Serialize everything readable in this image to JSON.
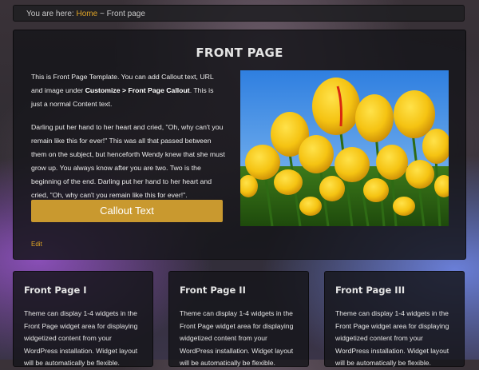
{
  "breadcrumb": {
    "prefix": "You are here:",
    "home_label": "Home",
    "separator": "~",
    "current": "Front page"
  },
  "main": {
    "title": "FRONT PAGE",
    "intro_text_1": "This is Front Page Template. You can add Callout text, URL and image under ",
    "intro_bold": "Customize > Front Page Callout",
    "intro_text_2": ". This is just a normal Content text.",
    "paragraph": "Darling put her hand to her heart and cried, \"Oh, why can't you remain like this for ever!\" This was all that passed between them on the subject, but henceforth Wendy knew that she must grow up. You always know after you are two. Two is the beginning of the end. Darling put her hand to her heart and cried, \"Oh, why can't you remain like this for ever!\".",
    "callout_label": "Callout Text",
    "edit_label": "Edit",
    "image_icon": "tulips-photo"
  },
  "widgets": [
    {
      "title": "Front Page I",
      "text": "Theme can display 1-4 widgets in the Front Page widget area for displaying widgetized content from your WordPress installation. Widget layout will be automatically be flexible."
    },
    {
      "title": "Front Page II",
      "text": "Theme can display 1-4 widgets in the Front Page widget area for displaying widgetized content from your WordPress installation. Widget layout will be automatically be flexible."
    },
    {
      "title": "Front Page III",
      "text": "Theme can display 1-4 widgets in the Front Page widget area for displaying widgetized content from your WordPress installation. Widget layout will be automatically be flexible."
    }
  ],
  "colors": {
    "accent": "#e0a526",
    "callout": "#c9992f",
    "panel": "#16161a"
  }
}
